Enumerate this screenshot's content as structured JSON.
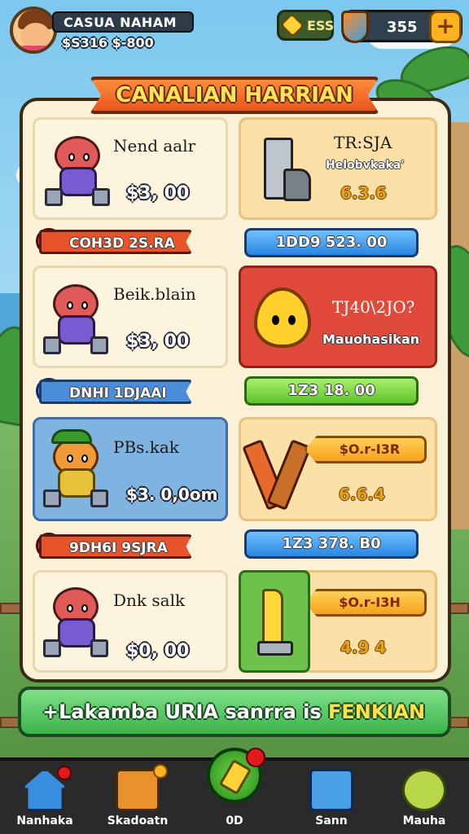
{
  "player": {
    "name": "CASUA NAHAM",
    "sub": "$S316 $-800"
  },
  "currencies": {
    "gems": "ESS",
    "coins": "355",
    "plus": "+"
  },
  "shop": {
    "title": "CANALIAN HARRIAN"
  },
  "left_items": [
    {
      "name": "Nend aalr",
      "price": "$3, 00"
    },
    {
      "name": "Beik.blain",
      "price": "$3, 00"
    },
    {
      "name": "PBs.kak",
      "price": "$3. 0,0om"
    },
    {
      "name": "Dnk salk",
      "price": "$0, 00"
    }
  ],
  "ribbons": [
    {
      "label": "COH3D 2S.RA",
      "color": "red"
    },
    {
      "label": "DNHI 1DJAAI",
      "color": "blue"
    },
    {
      "label": "9DH6I 9SJRA",
      "color": "red"
    }
  ],
  "right_items": [
    {
      "title": "TR:SJA",
      "sub": "Helobvkaka'",
      "value": "6.3.6",
      "icon": "machine-icon"
    },
    {
      "title": "TJ40\\2JO?",
      "sub": "Mauohasikan",
      "value": "",
      "icon": "flame-icon"
    },
    {
      "title": "",
      "sub": "$O.r-I3R",
      "value": "6.6.4",
      "icon": "torch-icon"
    },
    {
      "title": "",
      "sub": "$O.r-I3H",
      "value": "4.9 4",
      "icon": "drill-icon"
    }
  ],
  "bars": [
    {
      "label": "1DD9 523. 00",
      "color": "blue"
    },
    {
      "label": "1Z3 18. 00",
      "color": "green"
    },
    {
      "label": "1Z3 378. B0",
      "color": "blue"
    }
  ],
  "action": {
    "prefix": "+Lakamba URIA sanrra is",
    "highlight": "FENKIAN"
  },
  "nav": [
    {
      "label": "Nanhaka",
      "icon": "home-icon"
    },
    {
      "label": "Skadoatn",
      "icon": "crate-icon"
    },
    {
      "label": "0D",
      "icon": "center-icon"
    },
    {
      "label": "Sann",
      "icon": "screen-icon"
    },
    {
      "label": "Mauha",
      "icon": "medal-icon"
    }
  ]
}
